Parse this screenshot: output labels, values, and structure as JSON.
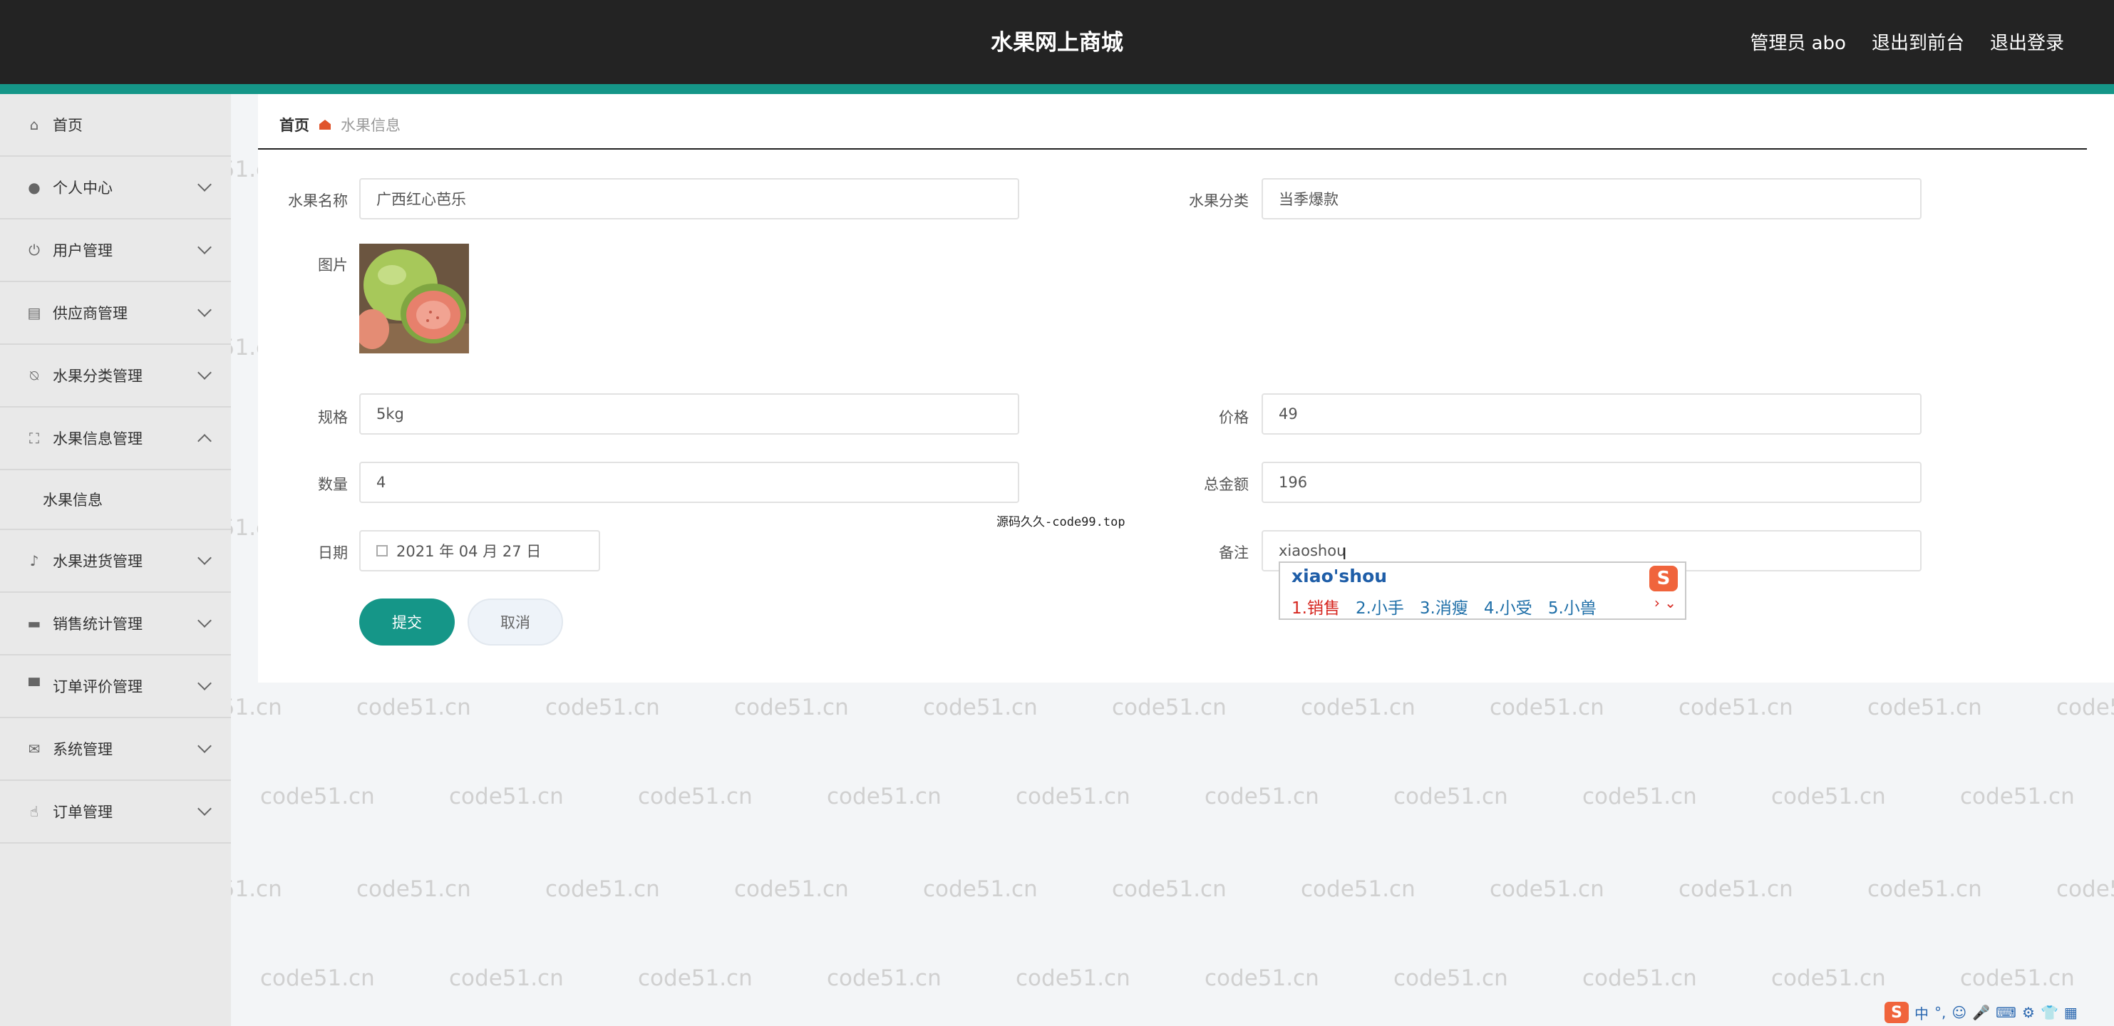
{
  "header": {
    "title": "水果网上商城",
    "admin": "管理员 abo",
    "front_link": "退出到前台",
    "logout": "退出登录"
  },
  "sidebar": {
    "items": [
      {
        "label": "首页",
        "icon": "home-icon"
      },
      {
        "label": "个人中心",
        "icon": "user-icon"
      },
      {
        "label": "用户管理",
        "icon": "power-icon"
      },
      {
        "label": "供应商管理",
        "icon": "clipboard-icon"
      },
      {
        "label": "水果分类管理",
        "icon": "bell-off-icon"
      },
      {
        "label": "水果信息管理",
        "icon": "expand-icon"
      },
      {
        "label": "水果进货管理",
        "icon": "microphone-icon"
      },
      {
        "label": "销售统计管理",
        "icon": "monitor-icon"
      },
      {
        "label": "订单评价管理",
        "icon": "stand-icon"
      },
      {
        "label": "系统管理",
        "icon": "mail-icon"
      },
      {
        "label": "订单管理",
        "icon": "thumb-icon"
      }
    ],
    "subitem": "水果信息"
  },
  "breadcrumb": {
    "home": "首页",
    "current": "水果信息"
  },
  "form": {
    "name_label": "水果名称",
    "name_value": "广西红心芭乐",
    "category_label": "水果分类",
    "category_value": "当季爆款",
    "image_label": "图片",
    "spec_label": "规格",
    "spec_value": "5kg",
    "price_label": "价格",
    "price_value": "49",
    "qty_label": "数量",
    "qty_value": "4",
    "total_label": "总金额",
    "total_value": "196",
    "date_label": "日期",
    "date_value": "2021 年 04 月 27 日",
    "remark_label": "备注",
    "remark_value": "xiaoshou",
    "submit": "提交",
    "cancel": "取消"
  },
  "overlay_text": "源码久久-code99.top",
  "ime": {
    "pinyin": "xiao'shou",
    "logo": "S",
    "candidates": [
      "1.销售",
      "2.小手",
      "3.消瘦",
      "4.小受",
      "5.小兽"
    ],
    "more": "› ⌄"
  },
  "tray": {
    "logo": "S",
    "items": [
      "中",
      "°,",
      "☺",
      "🎤",
      "⌨",
      "⚙",
      "👕",
      "▦"
    ]
  },
  "watermark": "code51.cn",
  "colors": {
    "header_bg": "#232323",
    "accent": "#159688",
    "sidebar_bg": "#e9e9e9",
    "ime_orange": "#f0643c"
  }
}
